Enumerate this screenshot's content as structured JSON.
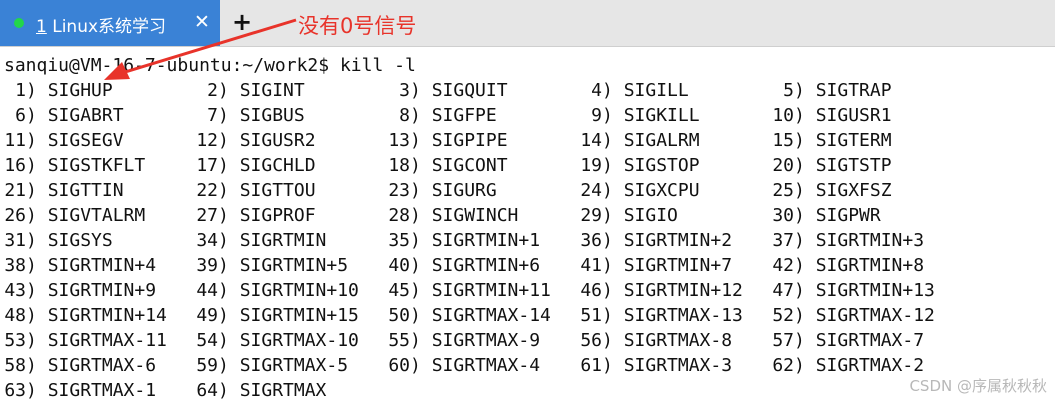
{
  "tabs": [
    {
      "number": "1",
      "title": "Linux系统学习",
      "status_color": "#22d64a",
      "close_symbol": "✕"
    }
  ],
  "new_tab_symbol": "+",
  "annotation": {
    "text": "没有0号信号",
    "color": "#e8332a"
  },
  "terminal": {
    "prompt": "sanqiu@VM-16-7-ubuntu:~/work2$ ",
    "command": "kill -l",
    "signals": [
      {
        "num": "1",
        "name": "SIGHUP"
      },
      {
        "num": "2",
        "name": "SIGINT"
      },
      {
        "num": "3",
        "name": "SIGQUIT"
      },
      {
        "num": "4",
        "name": "SIGILL"
      },
      {
        "num": "5",
        "name": "SIGTRAP"
      },
      {
        "num": "6",
        "name": "SIGABRT"
      },
      {
        "num": "7",
        "name": "SIGBUS"
      },
      {
        "num": "8",
        "name": "SIGFPE"
      },
      {
        "num": "9",
        "name": "SIGKILL"
      },
      {
        "num": "10",
        "name": "SIGUSR1"
      },
      {
        "num": "11",
        "name": "SIGSEGV"
      },
      {
        "num": "12",
        "name": "SIGUSR2"
      },
      {
        "num": "13",
        "name": "SIGPIPE"
      },
      {
        "num": "14",
        "name": "SIGALRM"
      },
      {
        "num": "15",
        "name": "SIGTERM"
      },
      {
        "num": "16",
        "name": "SIGSTKFLT"
      },
      {
        "num": "17",
        "name": "SIGCHLD"
      },
      {
        "num": "18",
        "name": "SIGCONT"
      },
      {
        "num": "19",
        "name": "SIGSTOP"
      },
      {
        "num": "20",
        "name": "SIGTSTP"
      },
      {
        "num": "21",
        "name": "SIGTTIN"
      },
      {
        "num": "22",
        "name": "SIGTTOU"
      },
      {
        "num": "23",
        "name": "SIGURG"
      },
      {
        "num": "24",
        "name": "SIGXCPU"
      },
      {
        "num": "25",
        "name": "SIGXFSZ"
      },
      {
        "num": "26",
        "name": "SIGVTALRM"
      },
      {
        "num": "27",
        "name": "SIGPROF"
      },
      {
        "num": "28",
        "name": "SIGWINCH"
      },
      {
        "num": "29",
        "name": "SIGIO"
      },
      {
        "num": "30",
        "name": "SIGPWR"
      },
      {
        "num": "31",
        "name": "SIGSYS"
      },
      {
        "num": "34",
        "name": "SIGRTMIN"
      },
      {
        "num": "35",
        "name": "SIGRTMIN+1"
      },
      {
        "num": "36",
        "name": "SIGRTMIN+2"
      },
      {
        "num": "37",
        "name": "SIGRTMIN+3"
      },
      {
        "num": "38",
        "name": "SIGRTMIN+4"
      },
      {
        "num": "39",
        "name": "SIGRTMIN+5"
      },
      {
        "num": "40",
        "name": "SIGRTMIN+6"
      },
      {
        "num": "41",
        "name": "SIGRTMIN+7"
      },
      {
        "num": "42",
        "name": "SIGRTMIN+8"
      },
      {
        "num": "43",
        "name": "SIGRTMIN+9"
      },
      {
        "num": "44",
        "name": "SIGRTMIN+10"
      },
      {
        "num": "45",
        "name": "SIGRTMIN+11"
      },
      {
        "num": "46",
        "name": "SIGRTMIN+12"
      },
      {
        "num": "47",
        "name": "SIGRTMIN+13"
      },
      {
        "num": "48",
        "name": "SIGRTMIN+14"
      },
      {
        "num": "49",
        "name": "SIGRTMIN+15"
      },
      {
        "num": "50",
        "name": "SIGRTMAX-14"
      },
      {
        "num": "51",
        "name": "SIGRTMAX-13"
      },
      {
        "num": "52",
        "name": "SIGRTMAX-12"
      },
      {
        "num": "53",
        "name": "SIGRTMAX-11"
      },
      {
        "num": "54",
        "name": "SIGRTMAX-10"
      },
      {
        "num": "55",
        "name": "SIGRTMAX-9"
      },
      {
        "num": "56",
        "name": "SIGRTMAX-8"
      },
      {
        "num": "57",
        "name": "SIGRTMAX-7"
      },
      {
        "num": "58",
        "name": "SIGRTMAX-6"
      },
      {
        "num": "59",
        "name": "SIGRTMAX-5"
      },
      {
        "num": "60",
        "name": "SIGRTMAX-4"
      },
      {
        "num": "61",
        "name": "SIGRTMAX-3"
      },
      {
        "num": "62",
        "name": "SIGRTMAX-2"
      },
      {
        "num": "63",
        "name": "SIGRTMAX-1"
      },
      {
        "num": "64",
        "name": "SIGRTMAX"
      }
    ]
  },
  "watermark": "CSDN @序属秋秋秋"
}
